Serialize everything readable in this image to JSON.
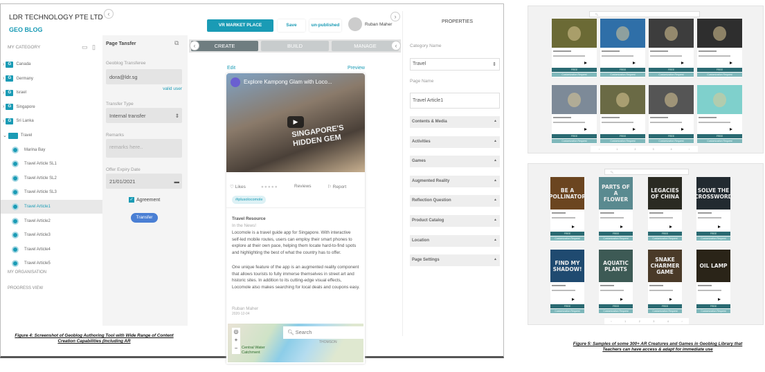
{
  "app": {
    "company": "LDR TECHNOLOGY PTE LTD",
    "product": "GEO BLOG"
  },
  "sidebar": {
    "header": "MY CATEGORY",
    "categories": [
      {
        "label": "Canada"
      },
      {
        "label": "Germany"
      },
      {
        "label": "Israel"
      },
      {
        "label": "Singapore"
      },
      {
        "label": "Sri Lanka"
      }
    ],
    "open_category": "Travel",
    "articles": [
      {
        "label": "Marina Bay"
      },
      {
        "label": "Travel Article SL1"
      },
      {
        "label": "Travel Article SL2"
      },
      {
        "label": "Travel Article SL3"
      },
      {
        "label": "Travel Article1",
        "selected": true
      },
      {
        "label": "Travel Article2"
      },
      {
        "label": "Travel Article3"
      },
      {
        "label": "Travel Article4"
      },
      {
        "label": "Travel Article5"
      }
    ],
    "sections": [
      "MY ORGANISATION",
      "PROGRESS VIEW"
    ],
    "folder_letter": "G"
  },
  "transfer": {
    "title": "Page Tansfer",
    "transferee_label": "Geoblog Transferee",
    "transferee_value": "dora@ldr.sg",
    "valid": "valid user",
    "type_label": "Transfer Type",
    "type_value": "Internal transfer",
    "remarks_label": "Remarks",
    "remarks_placeholder": "remarks here..",
    "expiry_label": "Offer Expiry Date",
    "expiry_value": "21/01/2021",
    "agreement": "Agreement",
    "agreement_checked": true,
    "button": "Transfer"
  },
  "toolbar": {
    "vr": "VR MARKET PLACE",
    "save": "Save",
    "status": "un-published",
    "user": "Ruban Maher"
  },
  "tabs": [
    "CREATE",
    "BUILD",
    "MANAGE"
  ],
  "post": {
    "edit": "Edit",
    "preview": "Preview",
    "video_title": "Explore Kampong Glam with Loco...",
    "overlay_line1": "SINGAPORE'S",
    "overlay_line2": "HIDDEN GEM",
    "likes": "Likes",
    "reviews": "Reviews",
    "report": "Report",
    "tag": "#iplusolocomole",
    "heading": "Travel Resource",
    "subheading": "In the News!",
    "p1": "Locomole is a travel guide app for Singapore. With interactive self-led mobile routes, users can employ their smart phones to explore at their own pace, helping them locate hard-to-find spots and highlighting the best of what the country has to offer.",
    "p2": "One unique feature of the app is an augmented reality component that allows tourists to fully immerse themselves in street art and historic sites. In addition to its cutting-edge visual effects, Locomole also makes searching for local deals and coupons easy.",
    "author": "Ruban Maher",
    "date": "2020-12-04",
    "map_search": "Search",
    "map_label1": "Central Water",
    "map_label2": "Catchment",
    "map_label3": "THOMSON"
  },
  "properties": {
    "title": "PROPERTIES",
    "category_label": "Category Name",
    "category_value": "Travel",
    "page_label": "Page Name",
    "page_value": "Travel Article1",
    "sections": [
      "Contents & Media",
      "Activities",
      "Games",
      "Augmented Reality",
      "Reflection Question",
      "Product Catalog",
      "Location",
      "Page Settings"
    ]
  },
  "captions": {
    "fig4_l1": "Figure 4: Screenshot of Geoblog Authoring Tool with Wide Range of Content",
    "fig4_l2": "Creation Capabilities (Including AR",
    "fig5_l1": "Figure 5: Samples of some 300+ AR Creatures and Games in Geoblog Library that",
    "fig5_l2": "Teachers can have access & adapt for immediate use"
  },
  "library": {
    "free": "FREE",
    "request": "Customization Request",
    "creatures": [
      {
        "color": "#6b6a35"
      },
      {
        "color": "#2f6fa8"
      },
      {
        "color": "#3d3d3d"
      },
      {
        "color": "#2e2e2e"
      },
      {
        "color": "#7d8a98"
      },
      {
        "color": "#6a6a45"
      },
      {
        "color": "#555"
      },
      {
        "color": "#7fd0cc"
      }
    ],
    "games": [
      {
        "title": "BE A POLLINATOR",
        "color": "#6b4520"
      },
      {
        "title": "PARTS OF A FLOWER",
        "color": "#5a8a90"
      },
      {
        "title": "LEGACIES OF CHINA",
        "color": "#2a2a22"
      },
      {
        "title": "SOLVE THE CROSSWORD",
        "color": "#222a30"
      },
      {
        "title": "FIND MY SHADOW!",
        "color": "#1f4a70"
      },
      {
        "title": "AQUATIC PLANTS",
        "color": "#3d5a55"
      },
      {
        "title": "SNAKE CHARMER GAME",
        "color": "#4a3a28"
      },
      {
        "title": "OIL LAMP",
        "color": "#2a2418"
      }
    ]
  },
  "colors": {
    "accent": "#1a9bb5",
    "library_dark": "#2a6a72",
    "library_light": "#7fb8bb"
  }
}
